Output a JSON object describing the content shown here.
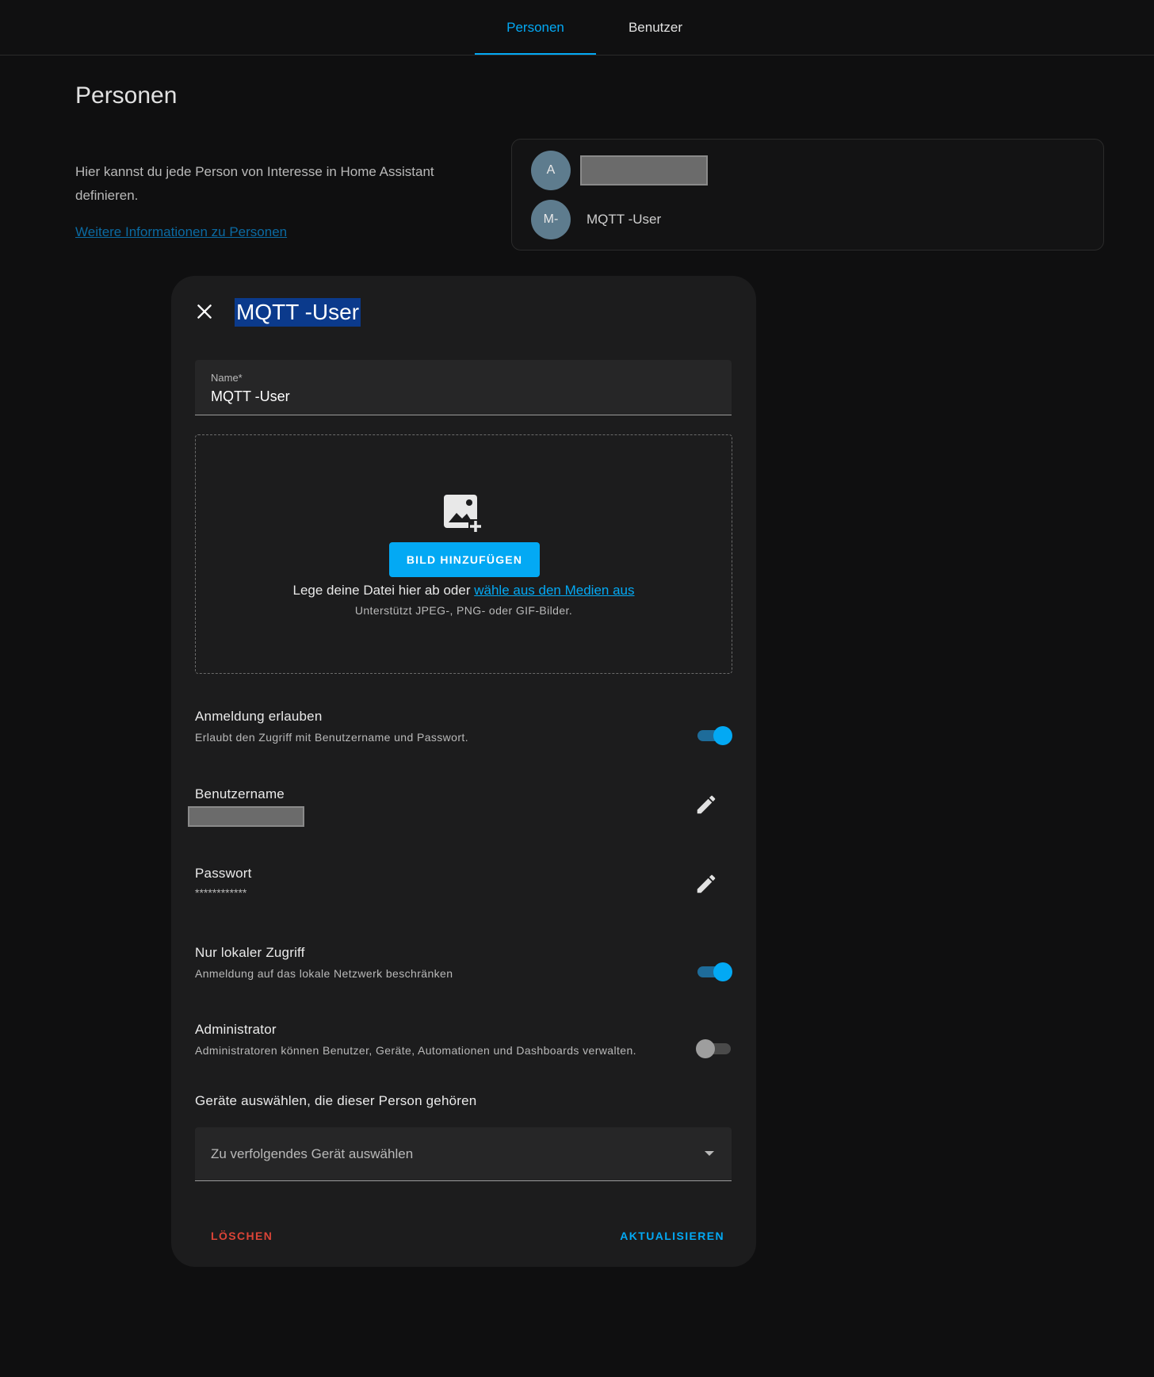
{
  "tabs": [
    {
      "label": "Personen",
      "active": true
    },
    {
      "label": "Benutzer",
      "active": false
    }
  ],
  "page": {
    "title": "Personen",
    "intro": "Hier kannst du jede Person von Interesse in Home Assistant definieren.",
    "more_link": "Weitere Informationen zu Personen"
  },
  "persons": [
    {
      "initials": "A",
      "name": "",
      "name_redacted": true
    },
    {
      "initials": "M-",
      "name": "MQTT -User",
      "name_redacted": false
    }
  ],
  "dialog": {
    "title": "MQTT -User",
    "close_icon": "close-icon",
    "name_field": {
      "label": "Name*",
      "value": "MQTT -User"
    },
    "upload": {
      "icon": "image-plus-icon",
      "button": "BILD HINZUFÜGEN",
      "drop_text": "Lege deine Datei hier ab oder",
      "drop_link": "wähle aus den Medien aus",
      "hint": "Unterstützt JPEG-, PNG- oder GIF-Bilder."
    },
    "allow_login": {
      "title": "Anmeldung erlauben",
      "desc": "Erlaubt den Zugriff mit Benutzername und Passwort.",
      "enabled": true
    },
    "username": {
      "title": "Benutzername",
      "value_redacted": true
    },
    "password": {
      "title": "Passwort",
      "value": "************"
    },
    "local_only": {
      "title": "Nur lokaler Zugriff",
      "desc": "Anmeldung auf das lokale Netzwerk beschränken",
      "enabled": true
    },
    "admin": {
      "title": "Administrator",
      "desc": "Administratoren können Benutzer, Geräte, Automationen und Dashboards verwalten.",
      "enabled": false
    },
    "devices": {
      "title": "Geräte auswählen, die dieser Person gehören",
      "placeholder": "Zu verfolgendes Gerät auswählen"
    },
    "delete_label": "LÖSCHEN",
    "update_label": "AKTUALISIEREN"
  },
  "colors": {
    "accent": "#03a9f4",
    "danger": "#db4437",
    "background": "#0f0f10",
    "dialog": "#1c1c1d",
    "avatar": "#5e7c8e",
    "title_highlight": "#0b3a8c"
  }
}
